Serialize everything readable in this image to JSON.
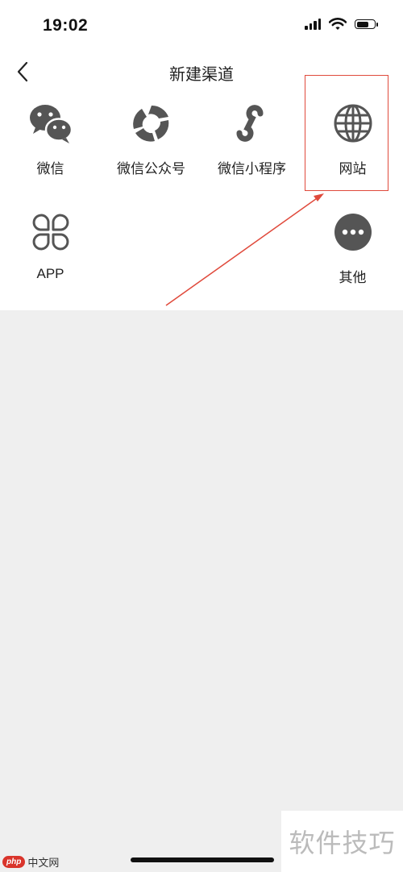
{
  "status_bar": {
    "time": "19:02"
  },
  "header": {
    "title": "新建渠道"
  },
  "channels": [
    {
      "label": "微信",
      "icon": "wechat-icon"
    },
    {
      "label": "微信公众号",
      "icon": "official-account-icon"
    },
    {
      "label": "微信小程序",
      "icon": "mini-program-icon"
    },
    {
      "label": "网站",
      "icon": "globe-icon"
    },
    {
      "label": "APP",
      "icon": "app-grid-icon"
    },
    {
      "label": "其他",
      "icon": "more-icon"
    }
  ],
  "annotation": {
    "color": "#e04a3c"
  },
  "watermarks": {
    "left_badge": "php",
    "left_text": "中文网",
    "right_text": "软件技巧"
  },
  "colors": {
    "icon": "#555555",
    "background": "#efefef",
    "panel": "#ffffff"
  }
}
